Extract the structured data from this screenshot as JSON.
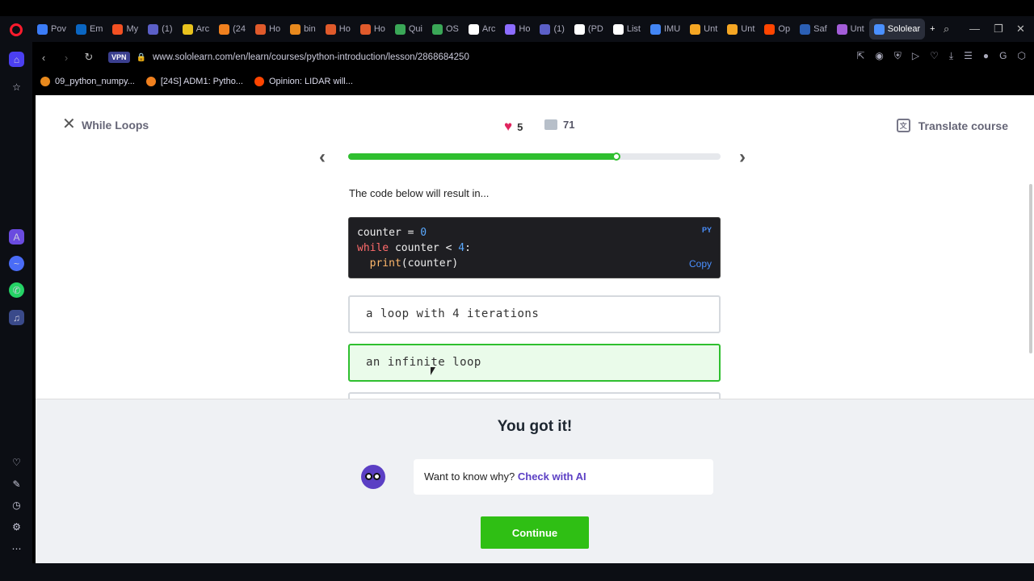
{
  "browser": {
    "tabs": [
      {
        "label": "Pov",
        "color": "#3b7cf7"
      },
      {
        "label": "Em",
        "color": "#0a66c2"
      },
      {
        "label": "My",
        "color": "#f25022"
      },
      {
        "label": "(1)",
        "color": "#5b5fc7"
      },
      {
        "label": "Arc",
        "color": "#e8c21d"
      },
      {
        "label": "(24",
        "color": "#f0801e"
      },
      {
        "label": "Ho",
        "color": "#e05a2b"
      },
      {
        "label": "bin",
        "color": "#e8891d"
      },
      {
        "label": "Ho",
        "color": "#e05a2b"
      },
      {
        "label": "Ho",
        "color": "#e05a2b"
      },
      {
        "label": "Qui",
        "color": "#3aa757"
      },
      {
        "label": "OS",
        "color": "#3aa757"
      },
      {
        "label": "Arc",
        "color": "#ffffff"
      },
      {
        "label": "Ho",
        "color": "#8c6cff"
      },
      {
        "label": "(1)",
        "color": "#5b5fc7"
      },
      {
        "label": "(PD",
        "color": "#ffffff"
      },
      {
        "label": "List",
        "color": "#ffffff"
      },
      {
        "label": "IMU",
        "color": "#4285f4"
      },
      {
        "label": "Unt",
        "color": "#f5a623"
      },
      {
        "label": "Unt",
        "color": "#f5a623"
      },
      {
        "label": "Op",
        "color": "#ff4500"
      },
      {
        "label": "Saf",
        "color": "#2b5fb4"
      },
      {
        "label": "Unt",
        "color": "#a35dd8"
      },
      {
        "label": "Sololear",
        "color": "#4a90ff"
      }
    ],
    "url": "www.sololearn.com/en/learn/courses/python-introduction/lesson/2868684250",
    "vpn_label": "VPN",
    "bookmarks": [
      {
        "label": "09_python_numpy...",
        "color": "#e8891d"
      },
      {
        "label": "[24S] ADM1: Pytho...",
        "color": "#f0801e"
      },
      {
        "label": "Opinion: LIDAR will...",
        "color": "#ff4500"
      }
    ]
  },
  "lesson": {
    "title": "While Loops",
    "hearts": "5",
    "comments": "71",
    "translate_label": "Translate course",
    "progress": 0.72,
    "question": "The code below will result in...",
    "code": {
      "lang": "PY",
      "copy_label": "Copy",
      "line1_var": "counter = ",
      "line1_num": "0",
      "line2_kw": "while",
      "line2_rest": " counter < ",
      "line2_num": "4",
      "line2_end": ":",
      "line3_fn": "  print",
      "line3_rest": "(counter)"
    },
    "options": [
      {
        "text": "a loop with 4 iterations",
        "state": "default"
      },
      {
        "text": "an infinite loop",
        "state": "correct"
      }
    ]
  },
  "feedback": {
    "heading": "You got it!",
    "ai_prompt": "Want to know why?",
    "ai_link": "Check with AI",
    "continue_label": "Continue"
  },
  "colors": {
    "accent_green": "#2fbf14",
    "brand_purple": "#5b3fc4",
    "heart": "#e0245e"
  }
}
